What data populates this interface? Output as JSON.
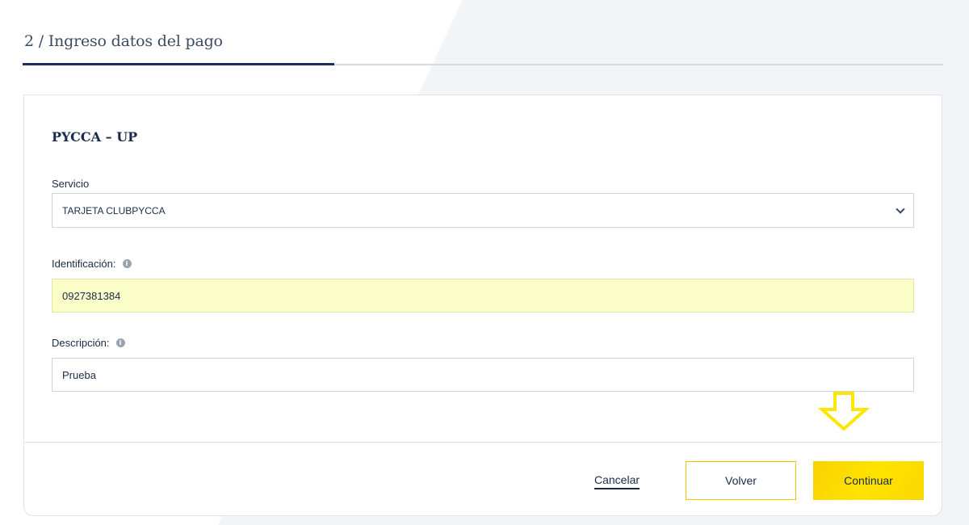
{
  "step": {
    "title": "2 / Ingreso datos del pago"
  },
  "card": {
    "title": "PYCCA – UP"
  },
  "servicio": {
    "label": "Servicio",
    "selected": "TARJETA CLUBPYCCA"
  },
  "identificacion": {
    "label": "Identificación:",
    "value": "0927381384"
  },
  "descripcion": {
    "label": "Descripción:",
    "value": "Prueba"
  },
  "icons": {
    "info": "i"
  },
  "actions": {
    "cancel": "Cancelar",
    "back": "Volver",
    "continue": "Continuar"
  },
  "colors": {
    "accent_yellow": "#ffe000",
    "navy": "#17305f",
    "autofill_bg": "#fafdc8"
  }
}
